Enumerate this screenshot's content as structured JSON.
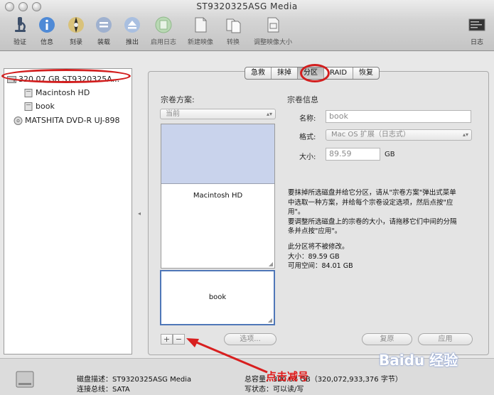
{
  "window": {
    "title": "ST9320325ASG Media"
  },
  "toolbar": {
    "items": [
      {
        "label": "验证",
        "icon": "microscope-icon"
      },
      {
        "label": "信息",
        "icon": "info-icon"
      },
      {
        "label": "刻录",
        "icon": "burn-disc-icon"
      },
      {
        "label": "装载",
        "icon": "mount-icon"
      },
      {
        "label": "推出",
        "icon": "eject-icon"
      },
      {
        "label": "启用日志",
        "icon": "log-icon"
      },
      {
        "label": "新建映像",
        "icon": "new-image-icon"
      },
      {
        "label": "转换",
        "icon": "convert-icon"
      },
      {
        "label": "调整映像大小",
        "icon": "resize-image-icon"
      }
    ],
    "log_label": "日志"
  },
  "sidebar": {
    "items": [
      {
        "label": "320.07 GB ST9320325A...",
        "icon": "hard-disk-icon",
        "level": 0,
        "selected": true
      },
      {
        "label": "Macintosh HD",
        "icon": "volume-icon",
        "level": 1
      },
      {
        "label": "book",
        "icon": "volume-icon",
        "level": 1
      },
      {
        "label": "MATSHITA DVD-R UJ-898",
        "icon": "optical-drive-icon",
        "level": 0
      }
    ]
  },
  "tabs": [
    {
      "label": "急救"
    },
    {
      "label": "抹掉"
    },
    {
      "label": "分区",
      "active": true
    },
    {
      "label": "RAID"
    },
    {
      "label": "恢复"
    }
  ],
  "partition": {
    "scheme_label": "宗卷方案:",
    "scheme_value": "当前",
    "volumes": [
      "Macintosh HD",
      "book"
    ],
    "add_label": "+",
    "remove_label": "−",
    "options_label": "选项...",
    "revert_label": "复原",
    "apply_label": "应用"
  },
  "volume_info": {
    "title": "宗卷信息",
    "name_label": "名称:",
    "name_value": "book",
    "format_label": "格式:",
    "format_value": "Mac OS 扩展（日志式）",
    "size_label": "大小:",
    "size_value": "89.59",
    "size_unit": "GB",
    "desc_lines": [
      "要抹掉所选磁盘并给它分区，请从\"宗卷方案\"弹出式菜单",
      "中选取一种方案，并给每个宗卷设定选项，然后点按\"应",
      "用\"。",
      "要调整所选磁盘上的宗卷的大小，请拖移它们中间的分隔",
      "条并点按\"应用\"。"
    ],
    "status_lines": [
      "此分区将不被修改。",
      "大小：89.59 GB",
      "可用空间：84.01 GB"
    ]
  },
  "bottom": {
    "desc_line": "磁盘描述：ST9320325ASG Media",
    "bus_line": "连接总线：SATA",
    "capacity_line": "总容量：320.07 GB（320,072,933,376 字节）",
    "status_line": "写状态：可以读/写"
  },
  "annotation": {
    "text": "点击减号"
  },
  "watermark": {
    "text": "Baidu 经验"
  }
}
